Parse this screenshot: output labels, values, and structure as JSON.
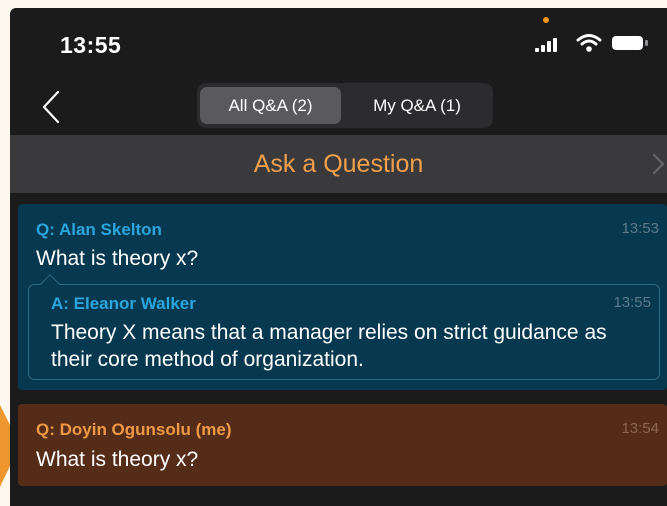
{
  "status_bar": {
    "time": "13:55"
  },
  "nav": {
    "tabs": [
      {
        "label": "All Q&A (2)",
        "selected": true
      },
      {
        "label": "My Q&A (1)",
        "selected": false
      }
    ]
  },
  "ask": {
    "label": "Ask a Question"
  },
  "questions": [
    {
      "author": "Q: Alan Skelton",
      "time": "13:53",
      "text": "What is theory x?",
      "answer": {
        "author": "A: Eleanor Walker",
        "time": "13:55",
        "text": "Theory X means that a manager relies on strict guidance as their core method of organization."
      }
    },
    {
      "author": "Q: Doyin Ogunsolu (me)",
      "time": "13:54",
      "text": "What is theory x?"
    }
  ],
  "colors": {
    "accent": "#f0a04b",
    "answered_card": "#06384f",
    "own_card": "#542c18",
    "blue_name": "#2ba6dd",
    "orange_name": "#ee9946"
  }
}
